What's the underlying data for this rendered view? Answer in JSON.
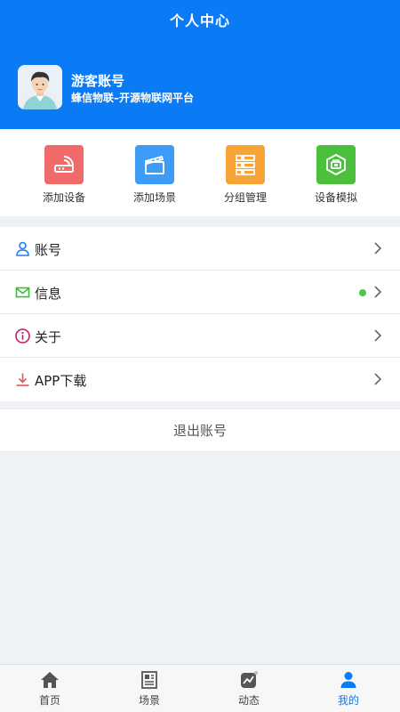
{
  "header": {
    "title": "个人中心",
    "user_name": "游客账号",
    "user_subtitle": "蜂信物联–开源物联网平台"
  },
  "quick_actions": [
    {
      "label": "添加设备",
      "color": "#f06a6a",
      "icon": "router-icon"
    },
    {
      "label": "添加场景",
      "color": "#3d9cf5",
      "icon": "clapperboard-icon"
    },
    {
      "label": "分组管理",
      "color": "#f7a335",
      "icon": "group-list-icon"
    },
    {
      "label": "设备模拟",
      "color": "#4cbf3c",
      "icon": "device-sim-icon"
    }
  ],
  "menu": [
    {
      "label": "账号",
      "icon": "user-icon",
      "icon_color": "#1f7ff0"
    },
    {
      "label": "信息",
      "icon": "mail-icon",
      "icon_color": "#3fb83f"
    },
    {
      "label": "关于",
      "icon": "info-icon",
      "icon_color": "#c21b66"
    },
    {
      "label": "APP下载",
      "icon": "download-icon",
      "icon_color": "#e5574d"
    }
  ],
  "logout_label": "退出账号",
  "tabs": [
    {
      "label": "首页",
      "icon": "home-icon"
    },
    {
      "label": "场景",
      "icon": "scene-icon"
    },
    {
      "label": "动态",
      "icon": "activity-icon"
    },
    {
      "label": "我的",
      "icon": "profile-icon"
    }
  ],
  "active_tab": "我的",
  "colors": {
    "header_bg": "#0a7bf5",
    "accent": "#0a7bf5",
    "page_bg": "#eef2f6",
    "notification_dot": "#4cc74c"
  }
}
